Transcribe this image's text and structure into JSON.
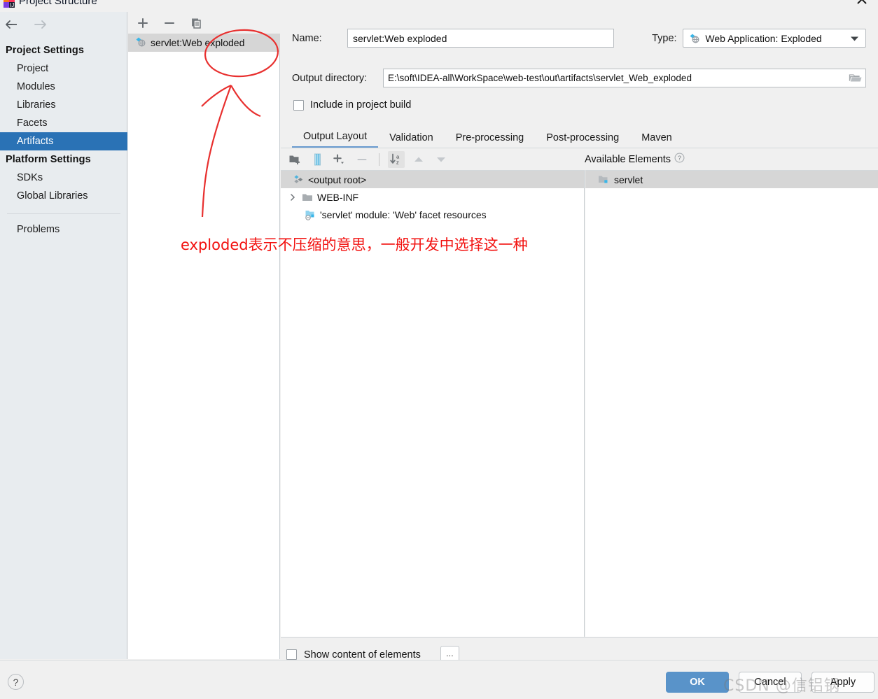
{
  "window": {
    "title": "Project Structure",
    "close_label": "✕",
    "app_icon": "intellij-idea-icon"
  },
  "sidebar": {
    "nav": {
      "back": "←",
      "forward": "→"
    },
    "groups": [
      {
        "label": "Project Settings",
        "items": [
          {
            "label": "Project",
            "selected": false
          },
          {
            "label": "Modules",
            "selected": false
          },
          {
            "label": "Libraries",
            "selected": false
          },
          {
            "label": "Facets",
            "selected": false
          },
          {
            "label": "Artifacts",
            "selected": true
          }
        ]
      },
      {
        "label": "Platform Settings",
        "items": [
          {
            "label": "SDKs",
            "selected": false
          },
          {
            "label": "Global Libraries",
            "selected": false
          }
        ]
      }
    ],
    "problems_label": "Problems",
    "selected_color": "#2a72b5"
  },
  "artifact_pane": {
    "toolbar": [
      {
        "name": "add-artifact-button",
        "glyph": "+"
      },
      {
        "name": "remove-artifact-button",
        "glyph": "−"
      },
      {
        "name": "copy-artifact-button",
        "glyph": "copy-icon"
      }
    ],
    "items": [
      {
        "label": "servlet:Web exploded",
        "icon": "web-exploded-artifact-icon",
        "selected": true
      }
    ]
  },
  "editor": {
    "name_label": "Name:",
    "name_value": "servlet:Web exploded",
    "type_label": "Type:",
    "type_value": "Web Application: Exploded",
    "type_icon": "web-exploded-artifact-icon",
    "output_dir_label": "Output directory:",
    "output_dir_value": "E:\\soft\\IDEA-all\\WorkSpace\\web-test\\out\\artifacts\\servlet_Web_exploded",
    "browse_icon": "folder-browse-icon",
    "include_in_build_label": "Include in project build",
    "include_in_build_checked": false,
    "tabs": [
      {
        "label": "Output Layout",
        "active": true
      },
      {
        "label": "Validation",
        "active": false
      },
      {
        "label": "Pre-processing",
        "active": false
      },
      {
        "label": "Post-processing",
        "active": false
      },
      {
        "label": "Maven",
        "active": false
      }
    ],
    "layout_toolbar": [
      {
        "name": "create-directory-button",
        "icon": "new-folder-icon"
      },
      {
        "name": "create-archive-button",
        "icon": "archive-icon"
      },
      {
        "name": "add-copy-button",
        "icon": "plus-dropdown-icon"
      },
      {
        "name": "remove-element-button",
        "icon": "minus-icon"
      },
      {
        "name": "sort-alphabetically-button",
        "icon": "sort-az-icon"
      },
      {
        "name": "move-up-button",
        "icon": "arrow-up-icon"
      },
      {
        "name": "move-down-button",
        "icon": "arrow-down-icon"
      }
    ],
    "available_elements_label": "Available Elements",
    "available_elements_help": "?",
    "output_tree": [
      {
        "label": "<output root>",
        "icon": "artifact-root-icon",
        "indent": 0,
        "twisty": "",
        "header": true
      },
      {
        "label": "WEB-INF",
        "icon": "folder-icon",
        "indent": 0,
        "twisty": "›",
        "header": false
      },
      {
        "label": "'servlet' module: 'Web' facet resources",
        "icon": "module-facet-icon",
        "indent": 1,
        "twisty": "",
        "header": false
      }
    ],
    "available_tree": [
      {
        "label": "servlet",
        "icon": "module-folder-icon",
        "header": true
      }
    ],
    "show_content_label": "Show content of elements",
    "show_content_checked": false,
    "show_content_more": "..."
  },
  "footer": {
    "help": "?",
    "ok_label": "OK",
    "cancel_label": "Cancel",
    "apply_label": "Apply",
    "ok_color": "#5993c9"
  },
  "annotations": {
    "text": "exploded表示不压缩的意思，一般开发中选择这一种",
    "color": "#f2110f",
    "shapes": [
      "ellipse-around-artifact",
      "hand-drawn-arrow-up"
    ]
  },
  "watermark": {
    "text": "CSDN @信铝锅"
  }
}
